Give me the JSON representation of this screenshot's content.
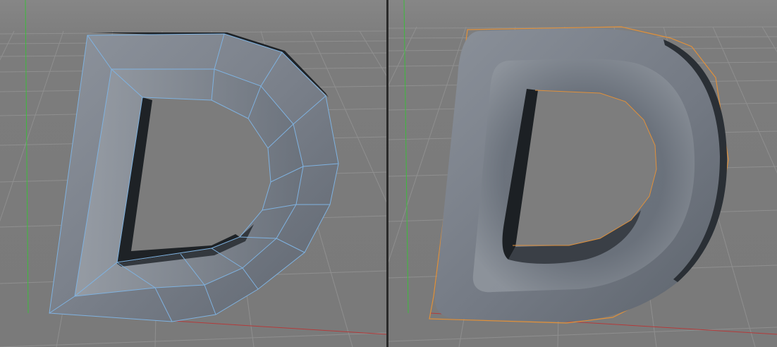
{
  "colors": {
    "background": "#7f7f7f",
    "horizon_band": "#8a8a8a",
    "grid_line": "#969696",
    "y_axis": "#3dbb3d",
    "x_axis": "#b43a3a",
    "z_axis": "#5a5ab4",
    "mesh_wire": "#7fb2e0",
    "selection_outline": "#e0903a",
    "surface_light": "#8a9099",
    "surface_mid": "#6e7580",
    "surface_dark": "#3c4148",
    "surface_shadow": "#1e2226"
  },
  "viewports": [
    {
      "name": "low-poly-cage-view",
      "object": "letter-d-cage",
      "display": "wireframe-on-shaded"
    },
    {
      "name": "subdivided-smooth-view",
      "object": "letter-d-smooth",
      "display": "smooth-shaded-selected"
    }
  ]
}
